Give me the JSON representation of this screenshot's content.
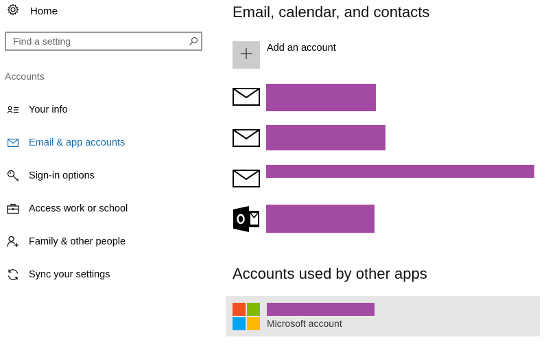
{
  "sidebar": {
    "home_label": "Home",
    "search_placeholder": "Find a setting",
    "section_title": "Accounts",
    "items": [
      {
        "label": "Your info"
      },
      {
        "label": "Email & app accounts"
      },
      {
        "label": "Sign-in options"
      },
      {
        "label": "Access work or school"
      },
      {
        "label": "Family & other people"
      },
      {
        "label": "Sync your settings"
      }
    ],
    "active_item": "Email & app accounts"
  },
  "main": {
    "email_heading": "Email, calendar, and contacts",
    "add_account_label": "Add an account",
    "accounts": [
      {
        "icon": "mail-icon",
        "name": "[redacted]"
      },
      {
        "icon": "mail-icon",
        "name": "[redacted]"
      },
      {
        "icon": "mail-icon",
        "name": "[redacted]"
      },
      {
        "icon": "outlook-icon",
        "name": "[redacted]"
      }
    ],
    "other_apps_heading": "Accounts used by other apps",
    "other_accounts": [
      {
        "icon": "microsoft-logo-icon",
        "name": "[redacted]",
        "subtitle": "Microsoft account"
      }
    ]
  },
  "colors": {
    "accent": "#1a6fb2",
    "redaction": "#a34aa3",
    "tile_gray": "#cccccc",
    "selected_row": "#e6e6e6",
    "ms_red": "#f25022",
    "ms_green": "#7fba00",
    "ms_blue": "#00a4ef",
    "ms_yellow": "#ffb900"
  }
}
